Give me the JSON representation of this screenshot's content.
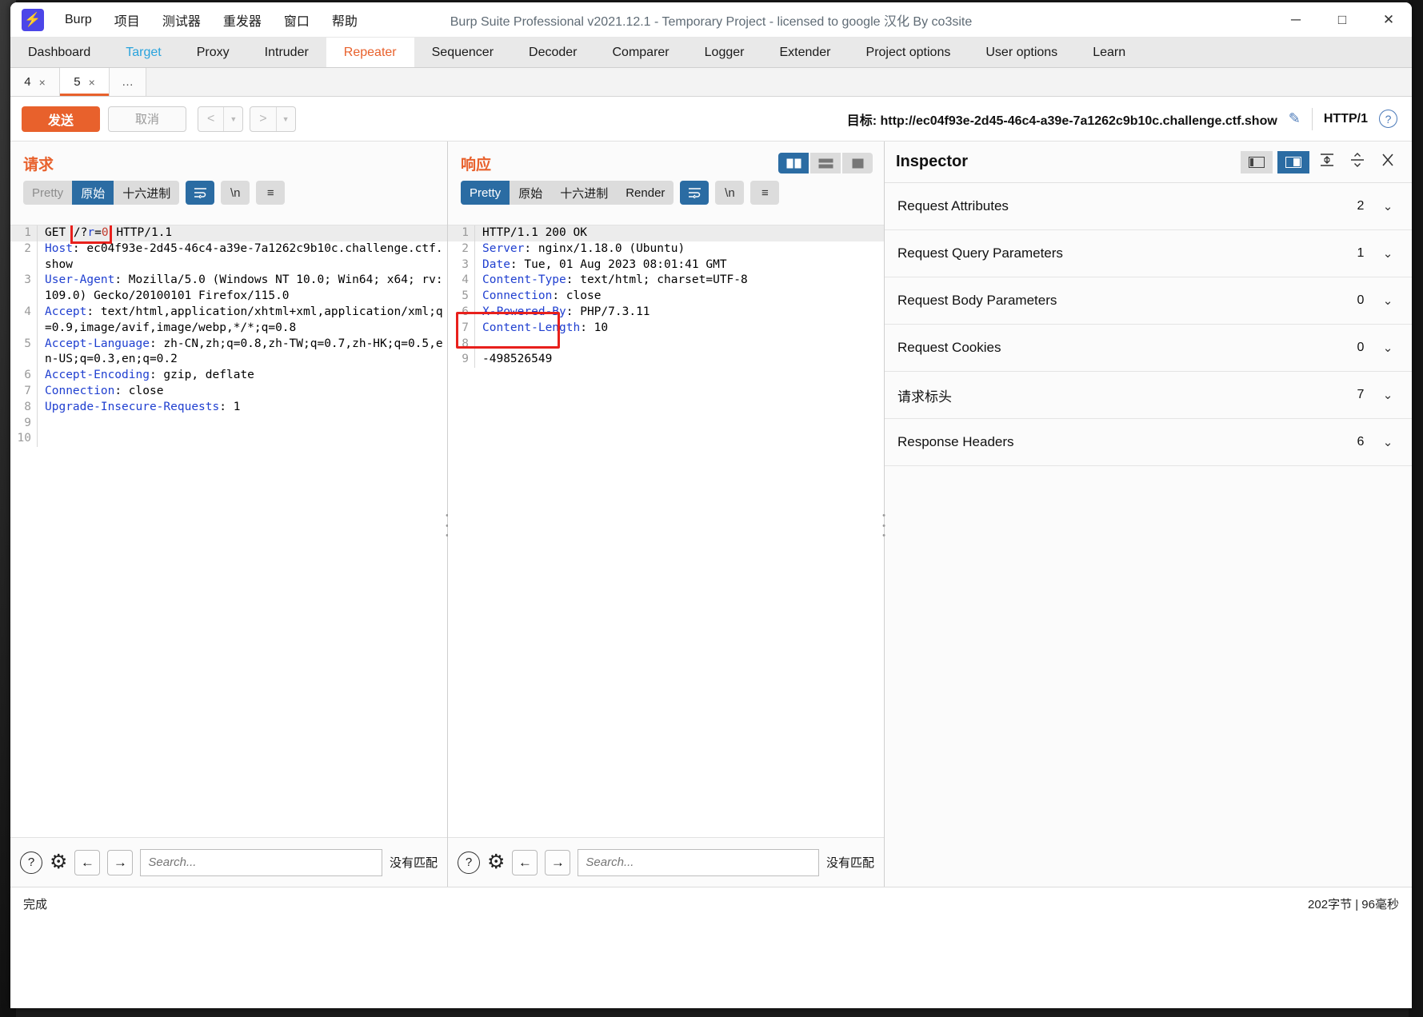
{
  "window": {
    "title": "Burp Suite Professional v2021.12.1 - Temporary Project - licensed to google 汉化 By co3site",
    "logo_icon": "burp-bolt-icon",
    "minimize_icon": "─",
    "maximize_icon": "□",
    "close_icon": "✕"
  },
  "menu": [
    {
      "label": "Burp"
    },
    {
      "label": "项目"
    },
    {
      "label": "测试器"
    },
    {
      "label": "重发器"
    },
    {
      "label": "窗口"
    },
    {
      "label": "帮助"
    }
  ],
  "main_tabs": [
    {
      "label": "Dashboard",
      "state": "normal"
    },
    {
      "label": "Target",
      "state": "accent"
    },
    {
      "label": "Proxy",
      "state": "normal"
    },
    {
      "label": "Intruder",
      "state": "normal"
    },
    {
      "label": "Repeater",
      "state": "active"
    },
    {
      "label": "Sequencer",
      "state": "normal"
    },
    {
      "label": "Decoder",
      "state": "normal"
    },
    {
      "label": "Comparer",
      "state": "normal"
    },
    {
      "label": "Logger",
      "state": "normal"
    },
    {
      "label": "Extender",
      "state": "normal"
    },
    {
      "label": "Project options",
      "state": "normal"
    },
    {
      "label": "User options",
      "state": "normal"
    },
    {
      "label": "Learn",
      "state": "normal"
    }
  ],
  "repeater_tabs": [
    {
      "label": "4",
      "close": "×",
      "active": false
    },
    {
      "label": "5",
      "close": "×",
      "active": true
    },
    {
      "label": "…",
      "close": "",
      "active": false
    }
  ],
  "toolbar": {
    "send_label": "发送",
    "cancel_label": "取消",
    "back_icon": "<",
    "back_caret": "▼",
    "forward_icon": ">",
    "forward_caret": "▼",
    "target_label": "目标:",
    "target_url": "http://ec04f93e-2d45-46c4-a39e-7a1262c9b10c.challenge.ctf.show",
    "edit_icon": "pencil-icon",
    "http_version": "HTTP/1",
    "help_icon": "?"
  },
  "request": {
    "title": "请求",
    "format_tabs": [
      {
        "label": "Pretty",
        "state": "muted"
      },
      {
        "label": "原始",
        "state": "on"
      },
      {
        "label": "十六进制",
        "state": "normal"
      }
    ],
    "wrap_icon": "word-wrap-icon",
    "newline_label": "\\n",
    "menu_icon": "≡",
    "lines": [
      {
        "num": "1",
        "highlight": true,
        "html": "GET <span class=\"redbox\">/?<span class=\"hk\">r</span>=<span class=\"rd\">0</span></span> HTTP/1.1"
      },
      {
        "num": "2",
        "highlight": false,
        "html": "<span class=\"hk\">Host</span>: ec04f93e-2d45-46c4-a39e-7a1262c9b10c.challenge.ctf.show"
      },
      {
        "num": "3",
        "highlight": false,
        "html": "<span class=\"hk\">User-Agent</span>: Mozilla/5.0 (Windows NT 10.0; Win64; x64; rv:109.0) Gecko/20100101 Firefox/115.0"
      },
      {
        "num": "4",
        "highlight": false,
        "html": "<span class=\"hk\">Accept</span>: text/html,application/xhtml+xml,application/xml;q=0.9,image/avif,image/webp,*/*;q=0.8"
      },
      {
        "num": "5",
        "highlight": false,
        "html": "<span class=\"hk\">Accept-Language</span>: zh-CN,zh;q=0.8,zh-TW;q=0.7,zh-HK;q=0.5,en-US;q=0.3,en;q=0.2"
      },
      {
        "num": "6",
        "highlight": false,
        "html": "<span class=\"hk\">Accept-Encoding</span>: gzip, deflate"
      },
      {
        "num": "7",
        "highlight": false,
        "html": "<span class=\"hk\">Connection</span>: close"
      },
      {
        "num": "8",
        "highlight": false,
        "html": "<span class=\"hk\">Upgrade-Insecure-Requests</span>: 1"
      },
      {
        "num": "9",
        "highlight": false,
        "html": ""
      },
      {
        "num": "10",
        "highlight": false,
        "html": ""
      }
    ],
    "search_placeholder": "Search...",
    "no_match": "没有匹配",
    "help_icon": "?",
    "settings_icon": "gear-icon",
    "prev_icon": "←",
    "next_icon": "→"
  },
  "response": {
    "title": "响应",
    "format_tabs": [
      {
        "label": "Pretty",
        "state": "on"
      },
      {
        "label": "原始",
        "state": "normal"
      },
      {
        "label": "十六进制",
        "state": "normal"
      },
      {
        "label": "Render",
        "state": "normal"
      }
    ],
    "wrap_icon": "word-wrap-icon",
    "newline_label": "\\n",
    "menu_icon": "≡",
    "view_modes": [
      {
        "icon": "split-vertical-icon",
        "on": true
      },
      {
        "icon": "split-horizontal-icon",
        "on": false
      },
      {
        "icon": "single-pane-icon",
        "on": false
      }
    ],
    "lines": [
      {
        "num": "1",
        "highlight": true,
        "html": "HTTP/1.1 200 OK"
      },
      {
        "num": "2",
        "highlight": false,
        "html": "<span class=\"hk\">Server</span>: nginx/1.18.0 (Ubuntu)"
      },
      {
        "num": "3",
        "highlight": false,
        "html": "<span class=\"hk\">Date</span>: Tue, 01 Aug 2023 08:01:41 GMT"
      },
      {
        "num": "4",
        "highlight": false,
        "html": "<span class=\"hk\">Content-Type</span>: text/html; charset=UTF-8"
      },
      {
        "num": "5",
        "highlight": false,
        "html": "<span class=\"hk\">Connection</span>: close"
      },
      {
        "num": "6",
        "highlight": false,
        "html": "<span class=\"hk\">X-Powered-By</span>: PHP/7.3.11"
      },
      {
        "num": "7",
        "highlight": false,
        "html": "<span class=\"hk\">Content-Length</span>: 10"
      },
      {
        "num": "8",
        "highlight": false,
        "html": ""
      },
      {
        "num": "9",
        "highlight": false,
        "html": "-498526549"
      }
    ],
    "search_placeholder": "Search...",
    "no_match": "没有匹配",
    "help_icon": "?",
    "settings_icon": "gear-icon",
    "prev_icon": "←",
    "next_icon": "→"
  },
  "inspector": {
    "title": "Inspector",
    "tools": [
      {
        "icon": "layout-left-icon",
        "on": false
      },
      {
        "icon": "layout-right-icon",
        "on": true
      },
      {
        "icon": "expand-all-icon",
        "on": false
      },
      {
        "icon": "collapse-all-icon",
        "on": false
      },
      {
        "icon": "close-icon",
        "on": false
      }
    ],
    "rows": [
      {
        "label": "Request Attributes",
        "count": "2",
        "chevron": "⌄"
      },
      {
        "label": "Request Query Parameters",
        "count": "1",
        "chevron": "⌄"
      },
      {
        "label": "Request Body Parameters",
        "count": "0",
        "chevron": "⌄"
      },
      {
        "label": "Request Cookies",
        "count": "0",
        "chevron": "⌄"
      },
      {
        "label": "请求标头",
        "count": "7",
        "chevron": "⌄"
      },
      {
        "label": "Response Headers",
        "count": "6",
        "chevron": "⌄"
      }
    ]
  },
  "status": {
    "left": "完成",
    "right": "202字节 | 96毫秒"
  }
}
